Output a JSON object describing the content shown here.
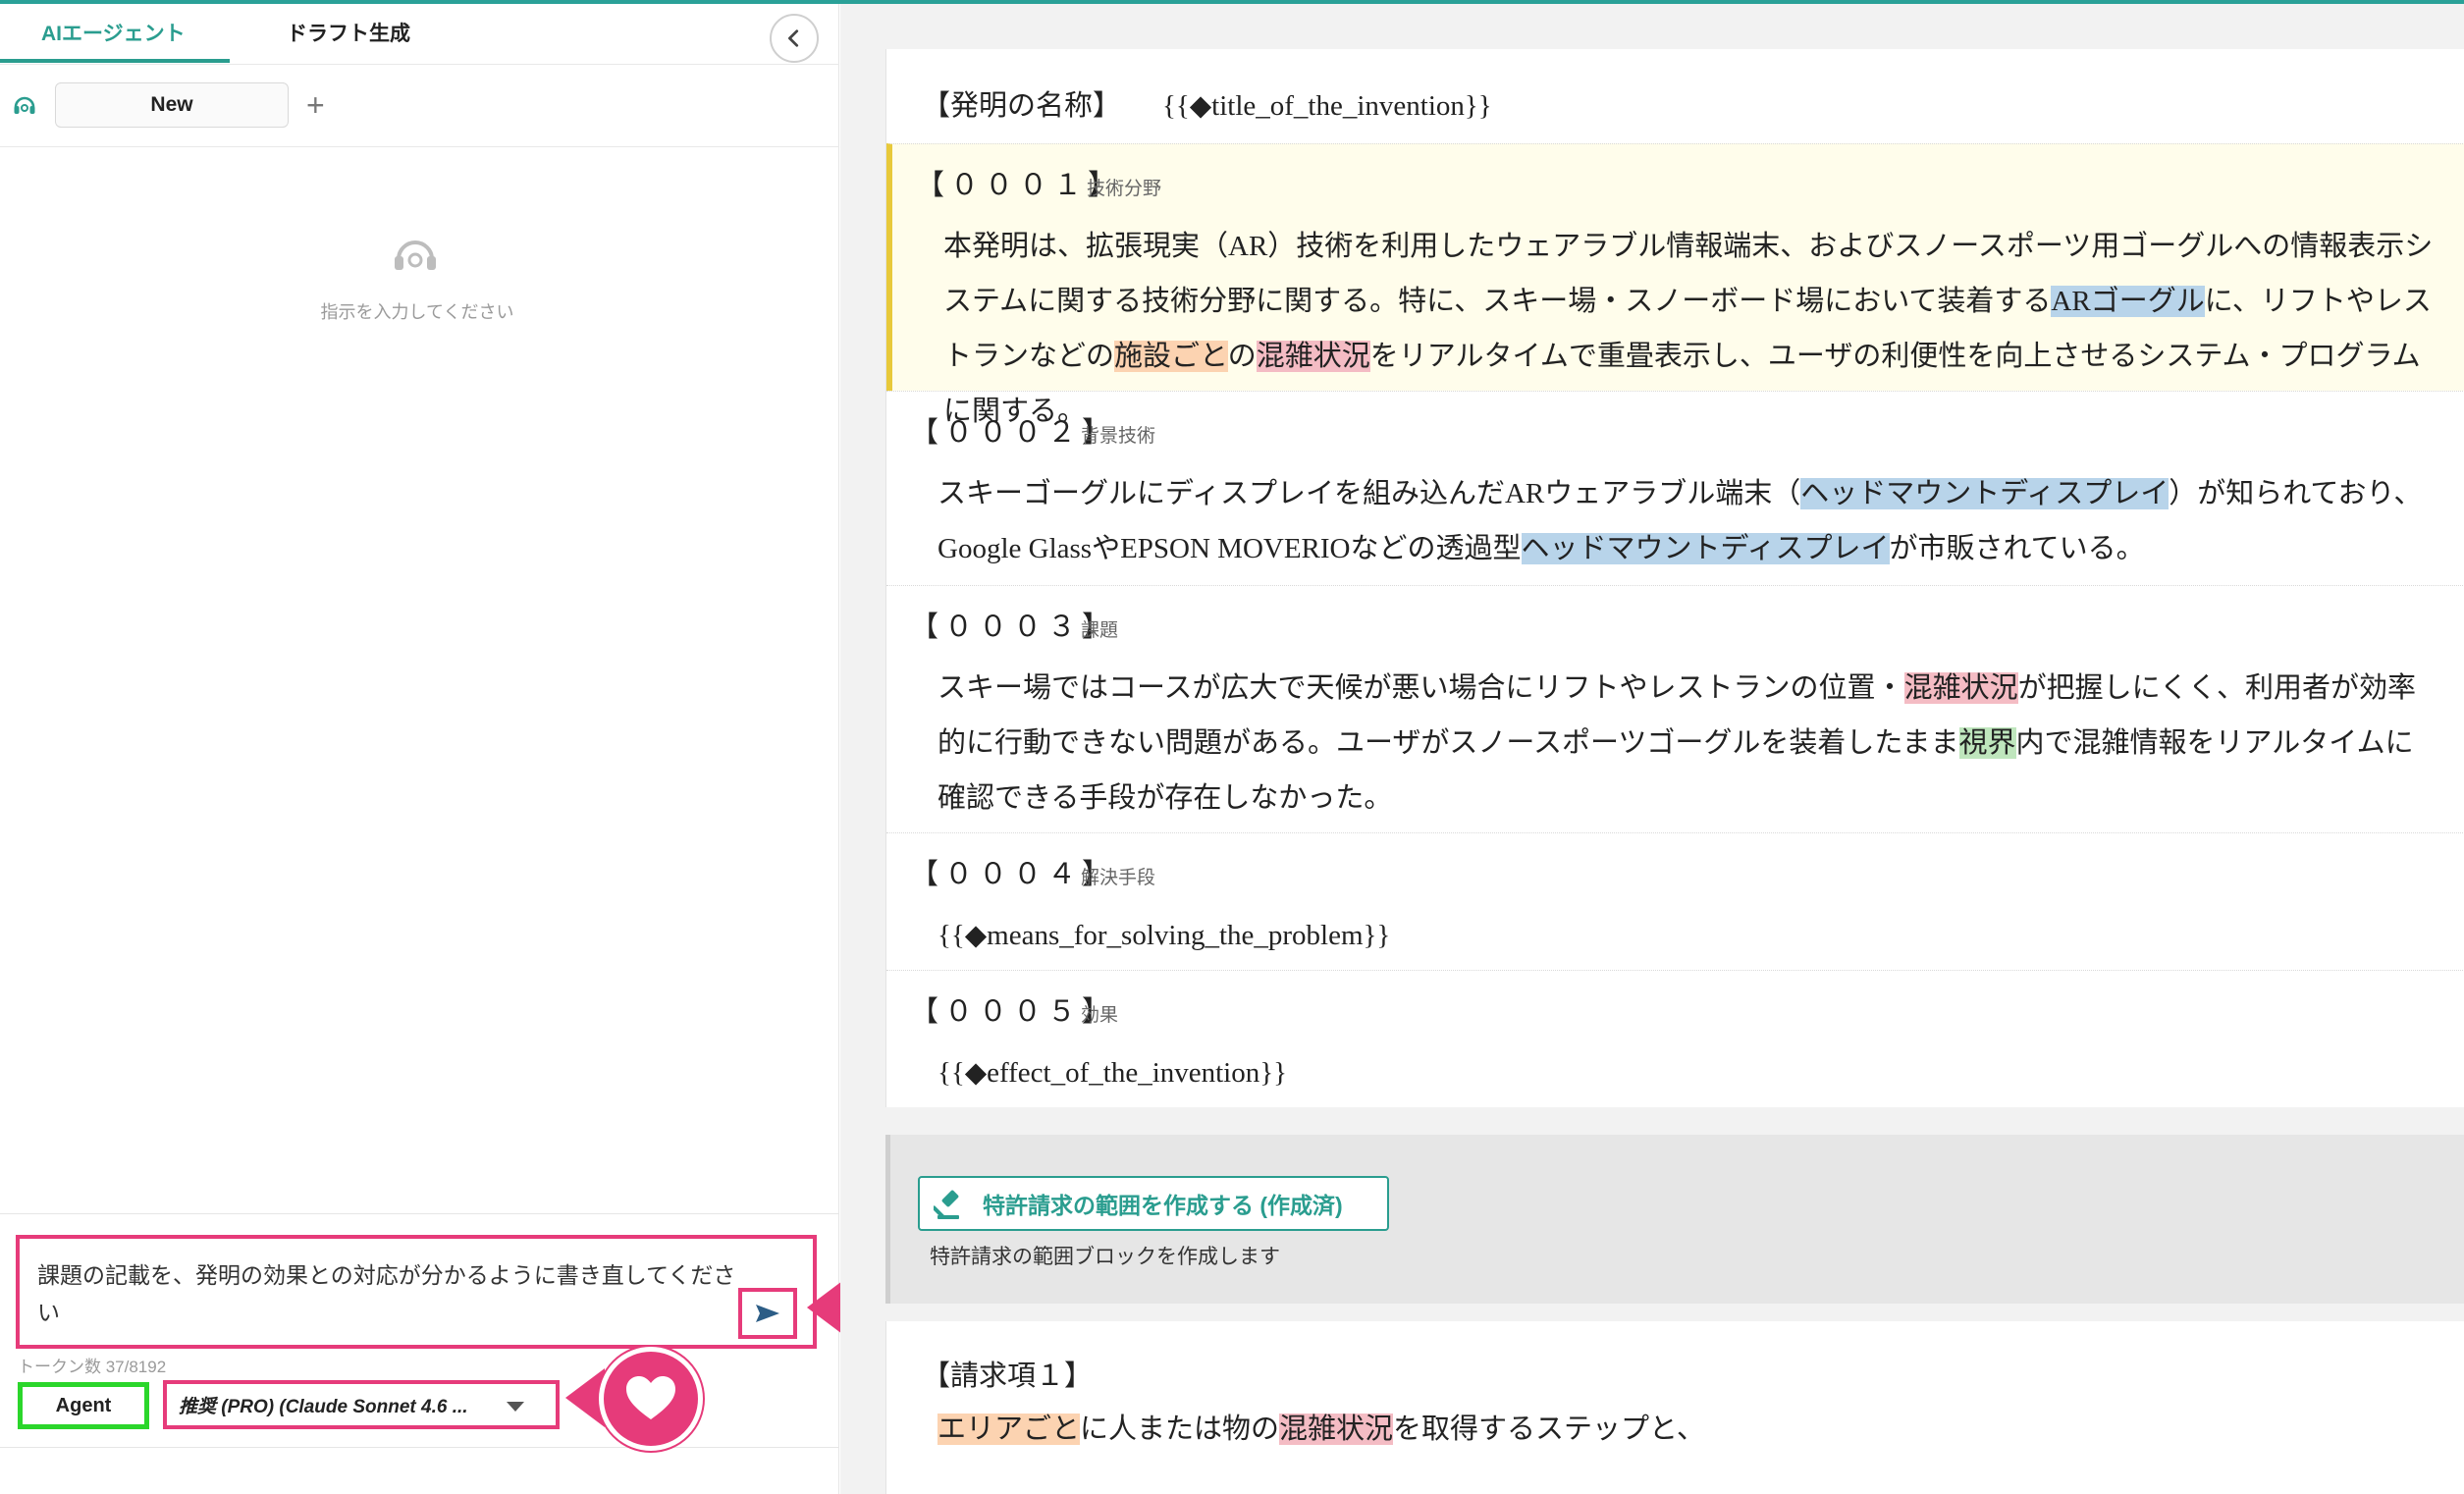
{
  "tabs": {
    "agent": "AIエージェント",
    "draft": "ドラフト生成"
  },
  "session": {
    "new_label": "New",
    "add_label": "+"
  },
  "empty_state": {
    "hint": "指示を入力してください"
  },
  "composer": {
    "text": "課題の記載を、発明の効果との対応が分かるように書き直してください",
    "tokens": "トークン数 37/8192",
    "mode": "Agent",
    "model": "推奨 (PRO) (Claude Sonnet 4.6 ..."
  },
  "document": {
    "title_label": "【発明の名称】",
    "title_placeholder": "{{◆title_of_the_invention}}",
    "paragraphs": [
      {
        "num": "【０００１】",
        "label": "技術分野",
        "segments": [
          {
            "t": "本発明は、拡張現実（AR）技術を利用したウェアラブル情報端末、およびスノースポーツ用ゴーグルへの情報表示システムに関する技術分野に関する。特に、スキー場・スノーボード場において装着する",
            "c": ""
          },
          {
            "t": "ARゴーグル",
            "c": "blue"
          },
          {
            "t": "に、リフトやレストランなどの",
            "c": ""
          },
          {
            "t": "施設ごと",
            "c": "orange"
          },
          {
            "t": "の",
            "c": ""
          },
          {
            "t": "混雑状況",
            "c": "red"
          },
          {
            "t": "をリアルタイムで重畳表示し、ユーザの利便性を向上させるシステム・プログラムに関する。",
            "c": ""
          }
        ]
      },
      {
        "num": "【０００２】",
        "label": "背景技術",
        "segments": [
          {
            "t": "スキーゴーグルにディスプレイを組み込んだARウェアラブル端末（",
            "c": ""
          },
          {
            "t": "ヘッドマウントディスプレイ",
            "c": "blue"
          },
          {
            "t": "）が知られており、Google GlassやEPSON MOVERIOなどの透過型",
            "c": ""
          },
          {
            "t": "ヘッドマウントディスプレイ",
            "c": "blue"
          },
          {
            "t": "が市販されている。",
            "c": ""
          }
        ]
      },
      {
        "num": "【０００３】",
        "label": "課題",
        "segments": [
          {
            "t": "スキー場ではコースが広大で天候が悪い場合にリフトやレストランの位置・",
            "c": ""
          },
          {
            "t": "混雑状況",
            "c": "red"
          },
          {
            "t": "が把握しにくく、利用者が効率的に行動できない問題がある。ユーザがスノースポーツゴーグルを装着したまま",
            "c": ""
          },
          {
            "t": "視界",
            "c": "green"
          },
          {
            "t": "内で混雑情報をリアルタイムに確認できる手段が存在しなかった。",
            "c": ""
          }
        ]
      },
      {
        "num": "【０００４】",
        "label": "解決手段",
        "segments": [
          {
            "t": "{{◆means_for_solving_the_problem}}",
            "c": ""
          }
        ]
      },
      {
        "num": "【０００５】",
        "label": "効果",
        "segments": [
          {
            "t": "{{◆effect_of_the_invention}}",
            "c": ""
          }
        ]
      }
    ],
    "claims_button": "特許請求の範囲を作成する (作成済)",
    "claims_desc": "特許請求の範囲ブロックを作成します",
    "claim_head": "【請求項１】",
    "claim_segments": [
      {
        "t": "エリアごと",
        "c": "orange"
      },
      {
        "t": "に人または物の",
        "c": ""
      },
      {
        "t": "混雑状況",
        "c": "red"
      },
      {
        "t": "を取得するステップと、",
        "c": ""
      }
    ]
  },
  "colors": {
    "accent": "#2a9d8f",
    "annotation": "#e63b7a",
    "agent_outline": "#2bd62b",
    "highlight_bg": "#fffdeb"
  }
}
